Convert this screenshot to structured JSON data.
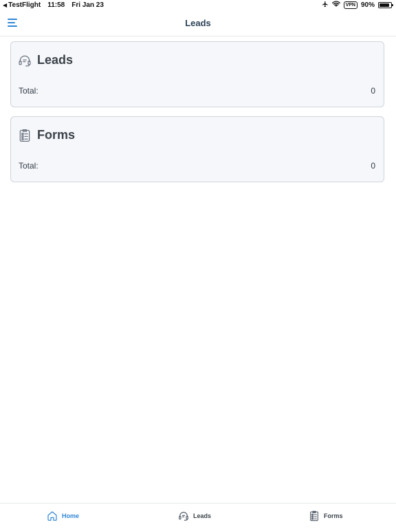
{
  "status_bar": {
    "back_app": "TestFlight",
    "time": "11:58",
    "date": "Fri Jan 23",
    "vpn": "VPN",
    "battery_text": "90%",
    "battery_level": 0.9
  },
  "nav": {
    "title": "Leads"
  },
  "cards": [
    {
      "title": "Leads",
      "total_label": "Total:",
      "total_value": "0",
      "icon": "headset-icon"
    },
    {
      "title": "Forms",
      "total_label": "Total:",
      "total_value": "0",
      "icon": "form-list-icon"
    }
  ],
  "tabs": [
    {
      "label": "Home",
      "icon": "home-icon",
      "active": true
    },
    {
      "label": "Leads",
      "icon": "headset-icon",
      "active": false
    },
    {
      "label": "Forms",
      "icon": "form-list-icon",
      "active": false
    }
  ],
  "colors": {
    "accent": "#2f86d6",
    "card_background": "#f6f7fb",
    "card_border": "#cfd4da",
    "nav_title": "#2d4257"
  }
}
